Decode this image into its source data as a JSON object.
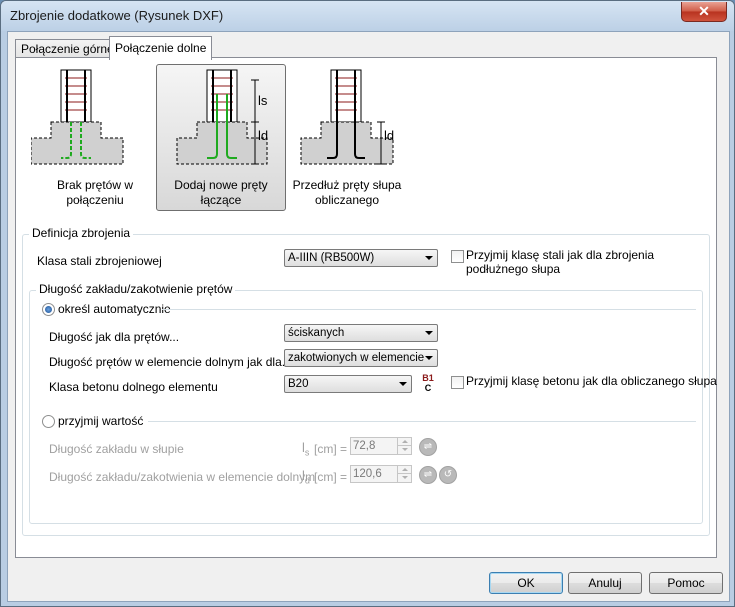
{
  "window": {
    "title": "Zbrojenie dodatkowe (Rysunek DXF)",
    "close_glyph": "✕"
  },
  "tabs": [
    {
      "label": "Połączenie górne",
      "active": false
    },
    {
      "label": "Połączenie dolne",
      "active": true
    }
  ],
  "options": [
    {
      "label": "Brak prętów w połączeniu",
      "selected": false
    },
    {
      "label": "Dodaj nowe pręty łączące",
      "selected": true
    },
    {
      "label": "Przedłuż pręty słupa obliczanego",
      "selected": false
    }
  ],
  "diagram_symbols": {
    "ls": "ls",
    "ld": "ld"
  },
  "definition": {
    "title": "Definicja zbrojenia",
    "steel_class_label": "Klasa stali zbrojeniowej",
    "steel_class_value": "A-IIIN (RB500W)",
    "steel_same_label": "Przyjmij klasę stali jak dla zbrojenia podłużnego słupa",
    "lap": {
      "title": "Długość zakładu/zakotwienie prętów",
      "auto": {
        "label": "określ automatycznie",
        "selected": true,
        "rows": [
          {
            "label": "Długość jak dla prętów...",
            "value": "ściskanych"
          },
          {
            "label": "Długość prętów w elemencie dolnym jak dla...",
            "value": "zakotwionych w elemencie"
          },
          {
            "label": "Klasa betonu dolnego elementu",
            "value": "B20"
          }
        ],
        "concrete_icon_text": "B1",
        "concrete_icon_sub": "C",
        "concrete_same_label": "Przyjmij klasę betonu jak dla obliczanego słupa"
      },
      "manual": {
        "label": "przyjmij wartość",
        "selected": false,
        "rows": [
          {
            "label": "Długość zakładu w słupie",
            "unit_symbol": "l",
            "unit_sub": "s",
            "unit": "[cm] =",
            "value": "72,8"
          },
          {
            "label": "Długość zakładu/zakotwienia w elemencie dolnym",
            "unit_symbol": "l",
            "unit_sub": "d",
            "unit": "[cm] =",
            "value": "120,6"
          }
        ]
      }
    }
  },
  "buttons": {
    "ok": "OK",
    "cancel": "Anuluj",
    "help": "Pomoc"
  },
  "colors": {
    "rebar_new": "#1faa1f",
    "rebar_column": "#8b1a1a",
    "concrete": "#d0d0d0"
  }
}
